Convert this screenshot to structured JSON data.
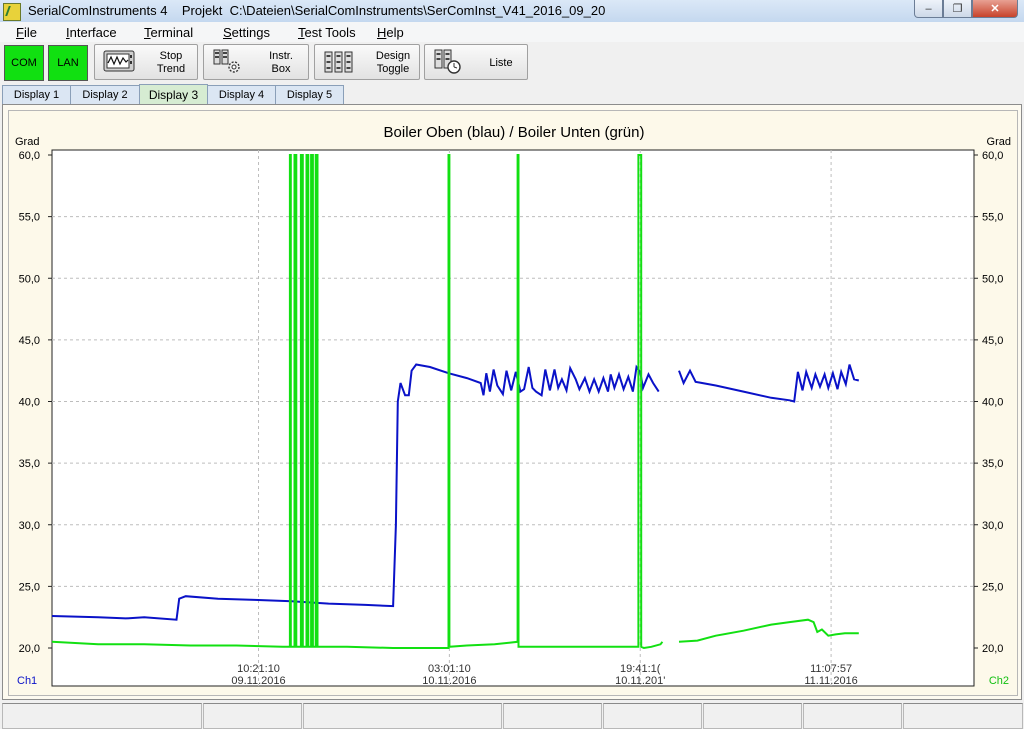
{
  "window": {
    "title": "SerialComInstruments 4    Projekt  C:\\Dateien\\SerialComInstruments\\SerComInst_V41_2016_09_20",
    "buttons": {
      "minimize": "–",
      "maximize": "❐",
      "close": "✕"
    }
  },
  "menu": [
    {
      "key": "F",
      "rest": "ile"
    },
    {
      "key": "I",
      "rest": "nterface"
    },
    {
      "key": "T",
      "rest": "erminal"
    },
    {
      "key": "S",
      "rest": "ettings"
    },
    {
      "key": "T",
      "rest": "est Tools"
    },
    {
      "key": "H",
      "rest": "elp"
    }
  ],
  "toolbar": {
    "com": "COM",
    "lan": "LAN",
    "stop_trend": [
      "Stop",
      "Trend"
    ],
    "instr_box": [
      "Instr.",
      "Box"
    ],
    "design_toggle": [
      "Design",
      "Toggle"
    ],
    "liste": "Liste",
    "led_color": "#11e011"
  },
  "tabs": [
    "Display 1",
    "Display 2",
    "Display 3",
    "Display 4",
    "Display 5"
  ],
  "active_tab": "Display 3",
  "chart_data": {
    "type": "line",
    "title": "Boiler Oben (blau) / Boiler Unten (grün)",
    "ylabel_left": "Grad",
    "ylabel_right": "Grad",
    "ylim": [
      20,
      60
    ],
    "yticks": [
      "60,0",
      "55,0",
      "50,0",
      "45,0",
      "40,0",
      "35,0",
      "30,0",
      "25,0",
      "20,0"
    ],
    "ytick_values": [
      60,
      55,
      50,
      45,
      40,
      35,
      30,
      25,
      20
    ],
    "xlim": [
      0,
      100
    ],
    "xticks": [
      {
        "x": 22.4,
        "time": "10:21:10",
        "date": "09.11.2016"
      },
      {
        "x": 43.1,
        "time": "03:01:10",
        "date": "10.11.2016"
      },
      {
        "x": 63.8,
        "time": "19:41:1(",
        "date": "10.11.201'"
      },
      {
        "x": 84.5,
        "time": "11:07:57",
        "date": "11.11.2016"
      }
    ],
    "grid": true,
    "channel_left": "Ch1",
    "channel_right": "Ch2",
    "series": [
      {
        "color": "#0a12c8",
        "segments": [
          [
            [
              0,
              22.6
            ],
            [
              5,
              22.5
            ],
            [
              8,
              22.4
            ],
            [
              10,
              22.5
            ],
            [
              13.5,
              22.3
            ],
            [
              13.5,
              22.3
            ],
            [
              13.8,
              24.0
            ],
            [
              14.5,
              24.2
            ],
            [
              18,
              24.0
            ],
            [
              22,
              23.9
            ],
            [
              26,
              23.8
            ],
            [
              30,
              23.6
            ],
            [
              34,
              23.5
            ],
            [
              37,
              23.4
            ],
            [
              37,
              23.4
            ],
            [
              37.3,
              30
            ],
            [
              37.5,
              40
            ],
            [
              37.8,
              41.5
            ],
            [
              38.3,
              40.5
            ],
            [
              38.7,
              40.5
            ],
            [
              39.0,
              42.5
            ],
            [
              39.5,
              43.0
            ],
            [
              41,
              42.8
            ],
            [
              43,
              42.3
            ],
            [
              45,
              41.9
            ],
            [
              46.5,
              41.5
            ],
            [
              46.8,
              40.5
            ],
            [
              47.1,
              42.3
            ],
            [
              47.5,
              40.8
            ],
            [
              47.9,
              42.6
            ],
            [
              48.3,
              41.3
            ],
            [
              48.9,
              40.6
            ],
            [
              49.3,
              42.5
            ],
            [
              49.8,
              40.9
            ],
            [
              50.3,
              42.4
            ],
            [
              50.8,
              40.8
            ],
            [
              51.2,
              41.0
            ],
            [
              51.7,
              42.8
            ],
            [
              52.1,
              41.1
            ],
            [
              52.5,
              40.8
            ],
            [
              53.1,
              40.5
            ],
            [
              53.5,
              42.6
            ],
            [
              54.0,
              40.9
            ],
            [
              54.5,
              42.6
            ],
            [
              54.9,
              41.1
            ],
            [
              55.3,
              41.8
            ],
            [
              55.8,
              40.9
            ],
            [
              56.2,
              42.7
            ],
            [
              56.8,
              41.8
            ],
            [
              57.2,
              41.0
            ],
            [
              57.8,
              41.9
            ],
            [
              58.3,
              40.8
            ],
            [
              58.8,
              41.8
            ],
            [
              59.3,
              40.8
            ],
            [
              59.8,
              41.9
            ],
            [
              60.3,
              40.8
            ],
            [
              60.6,
              42.2
            ],
            [
              61.0,
              41.1
            ],
            [
              61.5,
              42.2
            ],
            [
              62.0,
              41.0
            ],
            [
              62.5,
              42.0
            ],
            [
              63.0,
              40.8
            ],
            [
              63.4,
              42.8
            ],
            [
              63.8,
              42.4
            ],
            [
              64.1,
              41.1
            ],
            [
              64.7,
              42.2
            ],
            [
              65.2,
              41.5
            ],
            [
              65.8,
              40.8
            ]
          ],
          [
            [
              68,
              42.5
            ],
            [
              68.5,
              41.5
            ],
            [
              69.2,
              42.5
            ],
            [
              69.8,
              41.6
            ],
            [
              72,
              41.3
            ],
            [
              75,
              40.8
            ],
            [
              78,
              40.3
            ],
            [
              80,
              40.1
            ],
            [
              80.5,
              40.0
            ],
            [
              80.9,
              42.4
            ],
            [
              81.4,
              40.9
            ],
            [
              81.8,
              42.4
            ],
            [
              82.4,
              41.1
            ],
            [
              82.8,
              42.2
            ],
            [
              83.3,
              41.2
            ],
            [
              83.8,
              42.2
            ],
            [
              84.2,
              41.1
            ],
            [
              84.7,
              42.3
            ],
            [
              85.2,
              41.0
            ],
            [
              85.6,
              42.4
            ],
            [
              86.1,
              41.4
            ],
            [
              86.5,
              43.0
            ],
            [
              87.0,
              41.8
            ],
            [
              87.5,
              41.7
            ]
          ]
        ]
      },
      {
        "color": "#12e012",
        "segments": [
          [
            [
              0,
              20.5
            ],
            [
              5,
              20.3
            ],
            [
              10,
              20.3
            ],
            [
              15,
              20.2
            ],
            [
              20,
              20.2
            ],
            [
              25,
              20.1
            ],
            [
              25.8,
              20.1
            ],
            [
              25.8,
              60
            ],
            [
              25.9,
              60
            ],
            [
              25.9,
              20.1
            ],
            [
              26.3,
              20.1
            ],
            [
              26.3,
              60
            ],
            [
              26.5,
              60
            ],
            [
              26.5,
              20.1
            ],
            [
              27.0,
              20.1
            ],
            [
              27.0,
              60
            ],
            [
              27.2,
              60
            ],
            [
              27.2,
              20.1
            ],
            [
              27.6,
              20.1
            ],
            [
              27.6,
              60
            ],
            [
              27.8,
              60
            ],
            [
              27.8,
              20.1
            ],
            [
              28.1,
              20.1
            ],
            [
              28.1,
              60
            ],
            [
              28.3,
              60
            ],
            [
              28.3,
              20.1
            ],
            [
              28.6,
              20.1
            ],
            [
              28.6,
              60
            ],
            [
              28.8,
              60
            ],
            [
              28.8,
              20.1
            ],
            [
              32,
              20.1
            ],
            [
              37,
              20.0
            ],
            [
              42,
              20.0
            ],
            [
              43.0,
              20.0
            ],
            [
              43.0,
              60
            ],
            [
              43.1,
              60
            ],
            [
              43.1,
              20.1
            ],
            [
              45,
              20.2
            ],
            [
              48,
              20.3
            ],
            [
              50.5,
              20.5
            ],
            [
              50.5,
              60
            ],
            [
              50.6,
              60
            ],
            [
              50.6,
              20.1
            ],
            [
              55,
              20.1
            ],
            [
              60,
              20.1
            ],
            [
              63.6,
              20.1
            ],
            [
              63.6,
              60
            ],
            [
              63.9,
              60
            ],
            [
              63.9,
              20.1
            ],
            [
              64.2,
              20.0
            ],
            [
              65.0,
              20.1
            ],
            [
              66.0,
              20.3
            ],
            [
              66.2,
              20.5
            ]
          ],
          [
            [
              68,
              20.5
            ],
            [
              70,
              20.6
            ],
            [
              72,
              21.0
            ],
            [
              75,
              21.4
            ],
            [
              78,
              21.9
            ],
            [
              80,
              22.1
            ],
            [
              82,
              22.3
            ],
            [
              82.6,
              22.1
            ],
            [
              83.0,
              21.3
            ],
            [
              83.5,
              21.5
            ],
            [
              84.2,
              21.0
            ],
            [
              85,
              21.1
            ],
            [
              86,
              21.2
            ],
            [
              87.5,
              21.2
            ]
          ]
        ]
      }
    ]
  },
  "status": [
    "",
    "",
    "",
    "",
    "",
    "",
    "",
    "",
    "",
    ""
  ]
}
